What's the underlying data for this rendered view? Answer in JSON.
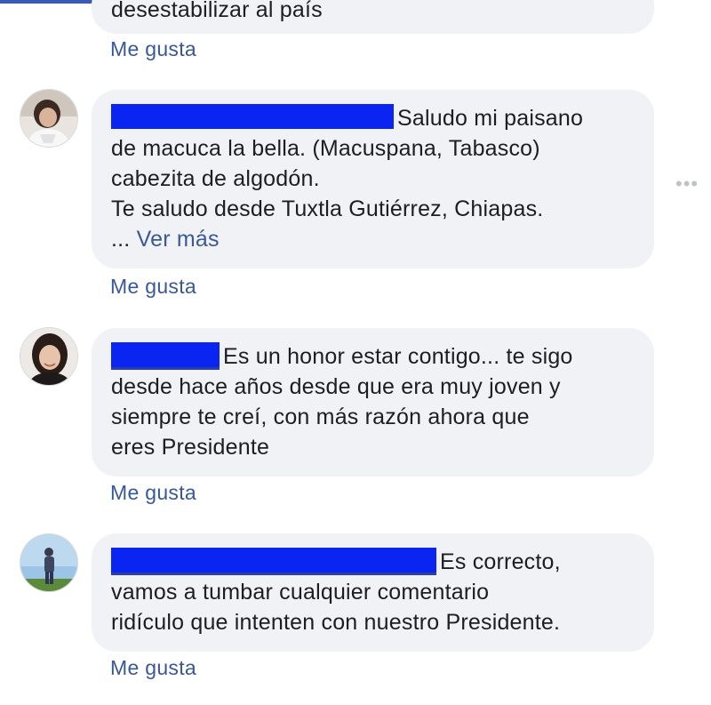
{
  "comments": [
    {
      "text_lines": [
        "desestabilizar al país"
      ],
      "like_label": "Me gusta"
    },
    {
      "text_lines": [
        "Saludo mi paisano",
        "de macuca la bella. (Macuspana, Tabasco)",
        "cabezita de algodón.",
        "Te saludo desde Tuxtla Gutiérrez, Chiapas."
      ],
      "more_prefix": "...",
      "more_label": "Ver más",
      "like_label": "Me gusta",
      "avatar": "avatar-woman-icon"
    },
    {
      "text_lines": [
        "Es un honor estar contigo... te sigo",
        "desde hace años desde que era muy joven y",
        "siempre te creí, con más razón ahora que",
        "eres Presidente"
      ],
      "like_label": "Me gusta",
      "avatar": "avatar-woman-icon"
    },
    {
      "text_lines": [
        "Es correcto,",
        "vamos a tumbar cualquier comentario",
        "ridículo que intenten con nuestro Presidente."
      ],
      "like_label": "Me gusta",
      "avatar": "avatar-man-standing-icon"
    }
  ],
  "options_icon": "more-options-icon",
  "colors": {
    "bubble": "#f0f2f5",
    "link": "#385898",
    "redaction": "#0a24f2"
  }
}
